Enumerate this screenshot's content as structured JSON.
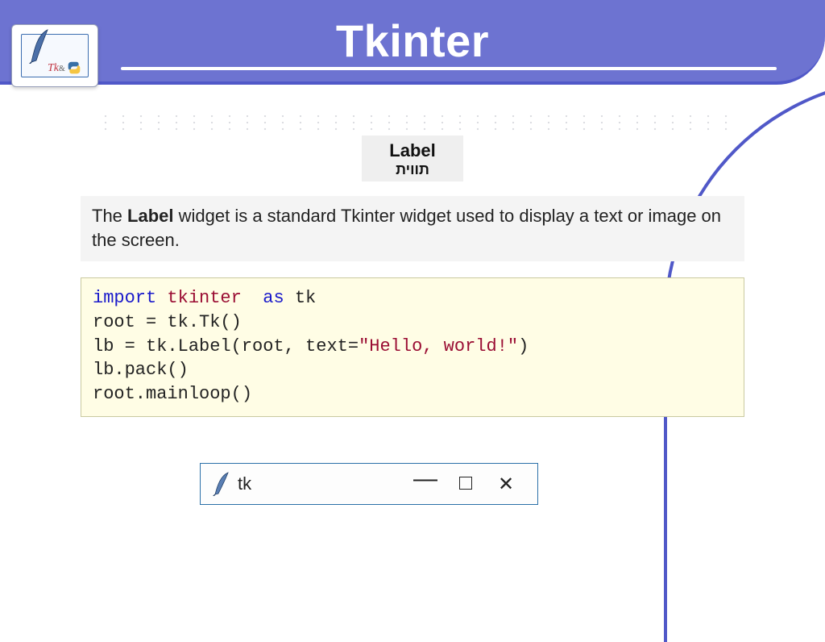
{
  "header": {
    "title": "Tkinter",
    "logo_text": "Tk",
    "logo_amp": "&"
  },
  "chip": {
    "title": "Label",
    "subtitle_he": "תווית"
  },
  "description": {
    "prefix": "The ",
    "bold": "Label",
    "rest": " widget is a standard Tkinter widget used to display a text or image on the screen."
  },
  "code": {
    "kw_import": "import",
    "mod_tkinter": "tkinter",
    "kw_as": "as",
    "alias": "tk",
    "line2": "root = tk.Tk()",
    "line3_pre": "lb = tk.Label(root, text=",
    "line3_str": "\"Hello, world!\"",
    "line3_post": ")",
    "line4": "lb.pack()",
    "line5": "root.mainloop()"
  },
  "tkwin": {
    "title": "tk",
    "minimize": "—",
    "close": "✕"
  }
}
